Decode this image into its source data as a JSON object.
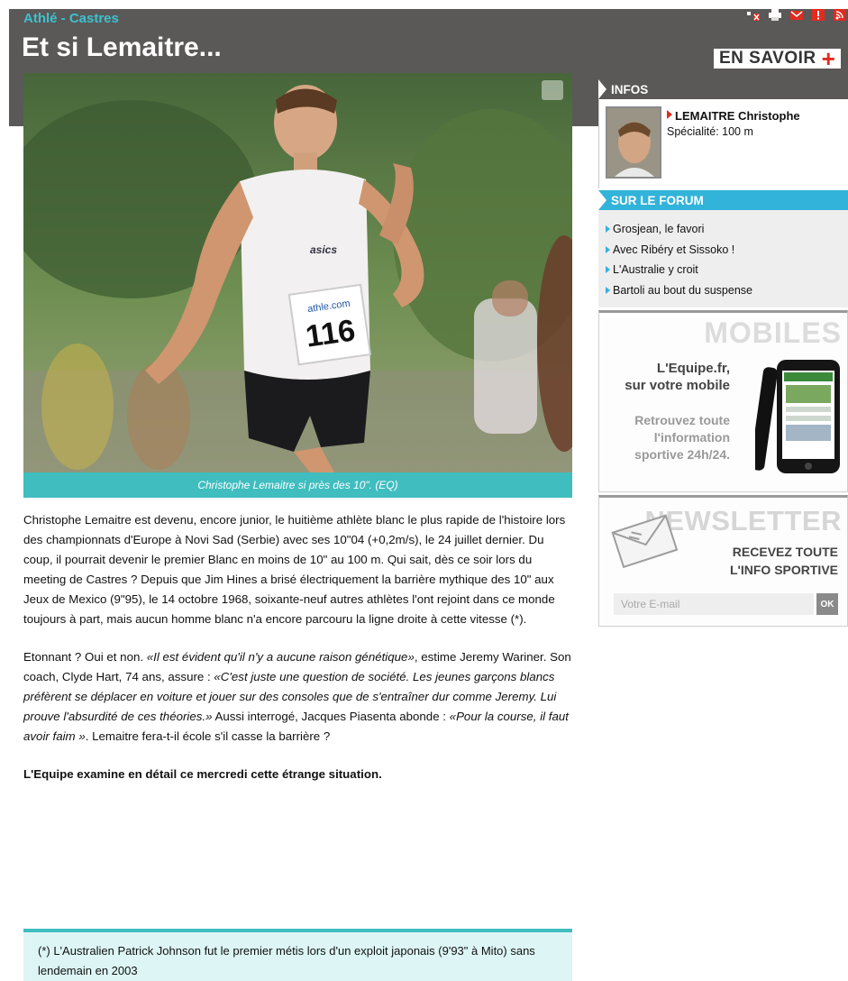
{
  "header": {
    "breadcrumb": "Athlé - Castres",
    "title": "Et si Lemaitre...",
    "en_savoir_label": "EN SAVOIR",
    "en_savoir_icon": "plus-icon",
    "tools": [
      "list-icon",
      "print-icon",
      "mail-icon",
      "alert-icon",
      "rss-icon"
    ]
  },
  "photo": {
    "bib_number": "116",
    "bib_sponsor": "athle.com",
    "shirt_brand": "asics",
    "caption": "Christophe Lemaitre si près des 10\". (EQ)"
  },
  "article": {
    "paragraph1": "Christophe Lemaitre est devenu, encore junior, le huitième athlète blanc le plus rapide de l'histoire lors des championnats d'Europe à Novi Sad (Serbie) avec ses 10\"04 (+0,2m/s), le 24 juillet dernier. Du coup, il pourrait devenir le premier Blanc en moins de 10\" au 100 m. Qui sait, dès ce soir lors du meeting de Castres ? Depuis que Jim Hines a brisé électriquement la barrière mythique des 10\" aux Jeux de Mexico (9\"95), le 14 octobre 1968, soixante-neuf autres athlètes l'ont rejoint dans ce monde toujours à part, mais aucun homme blanc n'a encore parcouru la ligne droite à cette vitesse (*).",
    "p2_a": "Etonnant ? Oui et non. ",
    "p2_b": "«Il est évident qu'il n'y a aucune raison génétique»",
    "p2_c": ", estime Jeremy Wariner. Son coach, Clyde Hart, 74 ans, assure : ",
    "p2_d": "«C'est juste une question de société. Les jeunes garçons blancs préfèrent se déplacer en voiture et jouer sur des consoles que de s'entraîner dur comme Jeremy. Lui prouve l'absurdité de ces théories.»",
    "p2_e": " Aussi interrogé, Jacques Piasenta abonde : ",
    "p2_f": "«Pour la course, il faut avoir faim »",
    "p2_g": ". Lemaitre fera-t-il école s'il casse la barrière ?",
    "paragraph3": "L'Equipe examine en détail ce mercredi cette étrange situation.",
    "footnote": "(*) L'Australien Patrick Johnson fut le premier métis lors d'un exploit japonais (9'93\" à Mito) sans lendemain en 2003"
  },
  "sidebar": {
    "infos_title": "INFOS",
    "person_name": "LEMAITRE Christophe",
    "person_specialty": "Spécialité: 100 m",
    "forum_title": "SUR LE FORUM",
    "forum_items": [
      "Grosjean, le favori",
      "Avec Ribéry et Sissoko !",
      "L'Australie y croit",
      "Bartoli au bout du suspense"
    ],
    "mobiles": {
      "word": "MOBILES",
      "line1": "L'Equipe.fr,",
      "line2": "sur votre mobile",
      "line3": "Retrouvez toute",
      "line4": "l'information",
      "line5": "sportive 24h/24."
    },
    "newsletter": {
      "word": "NEWSLETTER",
      "line1": "RECEVEZ TOUTE",
      "line2": "L'INFO SPORTIVE",
      "email_placeholder": "Votre E-mail",
      "ok_label": "OK"
    }
  },
  "colors": {
    "header_bg": "#5b5858",
    "accent_teal": "#3fbdbf",
    "forum_blue": "#32b3d9",
    "breadcrumb": "#39c3d0",
    "red": "#e12b1f"
  }
}
